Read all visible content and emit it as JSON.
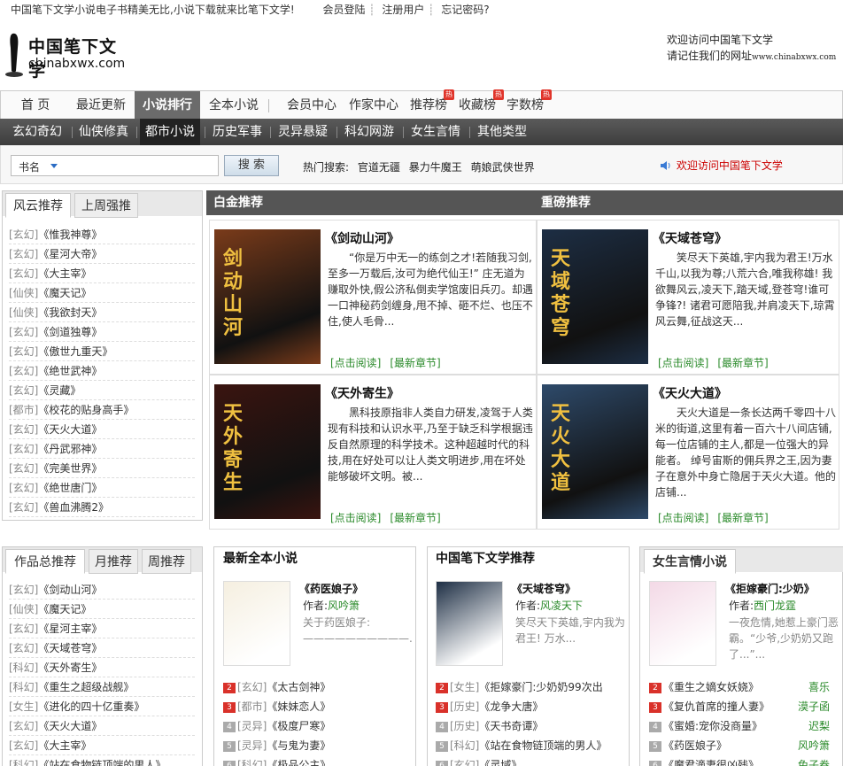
{
  "topbar": {
    "slogan": "中国笔下文学小说电子书精美无比,小说下载就来比笔下文学!",
    "login": "会员登陆",
    "register": "注册用户",
    "forgot": "忘记密码?"
  },
  "logo": {
    "cn": "中国笔下文学",
    "en": "chinabxwx.com"
  },
  "welcome": {
    "line1": "欢迎访问中国笔下文学",
    "line2": "请记住我们的网址",
    "url": "www.chinabxwx.com"
  },
  "nav": [
    "首 页",
    "最近更新",
    "小说排行",
    "全本小说",
    "会员中心",
    "作家中心",
    "推荐榜",
    "收藏榜",
    "字数榜"
  ],
  "hot_label": "热",
  "subnav": [
    "玄幻奇幻",
    "仙侠修真",
    "都市小说",
    "历史军事",
    "灵异悬疑",
    "科幻网游",
    "女生言情",
    "其他类型"
  ],
  "search": {
    "scope": "书名",
    "button": "搜 索",
    "hot_label": "热门搜索:",
    "hot": [
      "官道无疆",
      "暴力牛魔王",
      "萌娘武侠世界"
    ],
    "notice": "欢迎访问中国笔下文学"
  },
  "fengyun": {
    "tabs": [
      "风云推荐",
      "上周强推"
    ],
    "items": [
      [
        "[玄幻]",
        "《惟我神尊》"
      ],
      [
        "[玄幻]",
        "《星河大帝》"
      ],
      [
        "[玄幻]",
        "《大主宰》"
      ],
      [
        "[仙侠]",
        "《魔天记》"
      ],
      [
        "[仙侠]",
        "《我欲封天》"
      ],
      [
        "[玄幻]",
        "《剑道独尊》"
      ],
      [
        "[玄幻]",
        "《傲世九重天》"
      ],
      [
        "[玄幻]",
        "《绝世武神》"
      ],
      [
        "[玄幻]",
        "《灵藏》"
      ],
      [
        "[都市]",
        "《校花的贴身高手》"
      ],
      [
        "[玄幻]",
        "《天火大道》"
      ],
      [
        "[玄幻]",
        "《丹武邪神》"
      ],
      [
        "[玄幻]",
        "《完美世界》"
      ],
      [
        "[玄幻]",
        "《绝世唐门》"
      ],
      [
        "[玄幻]",
        "《兽血沸腾2》"
      ]
    ]
  },
  "baijin": {
    "title": "白金推荐"
  },
  "zhongbang": {
    "title": "重磅推荐"
  },
  "books": [
    {
      "title": "《剑动山河》",
      "desc": "“你是万中无一的练剑之才!若随我习剑,至多一万载后,汝可为绝代仙王!” 庄无道为赚取外快,假公济私倒卖学馆废旧兵刃。却遇一口神秘药剑缠身,甩不掉、砸不烂、也压不住,使人毛骨...",
      "read": "[点击阅读]",
      "latest": "[最新章节]",
      "cover_text": "剑动山河",
      "cover_color": "#7a3b1a"
    },
    {
      "title": "《天域苍穹》",
      "desc": "笑尽天下英雄,宇内我为君王!万水千山,以我为尊;八荒六合,唯我称雄! 我欲舞风云,凌天下,踏天域,登苍穹!谁可争锋?! 诸君可愿陪我,并肩凌天下,琼霄风云舞,征战这天...",
      "read": "[点击阅读]",
      "latest": "[最新章节]",
      "cover_text": "天域苍穹",
      "cover_color": "#1d2e44"
    },
    {
      "title": "《天外寄生》",
      "desc": "黑科技原指非人类自力研发,凌驾于人类现有科技和认识水平,乃至于缺乏科学根据违反自然原理的科学技术。这种超越时代的科技,用在好处可以让人类文明进步,用在坏处能够破坏文明。被...",
      "read": "[点击阅读]",
      "latest": "[最新章节]",
      "cover_text": "天外寄生",
      "cover_color": "#3a1410"
    },
    {
      "title": "《天火大道》",
      "desc": "天火大道是一条长达两千零四十八米的街道,这里有着一百六十八间店铺,每一位店铺的主人,都是一位强大的异能者。 绰号宙斯的佣兵界之王,因为妻子在意外中身亡隐居于天火大道。他的店铺...",
      "read": "[点击阅读]",
      "latest": "[最新章节]",
      "cover_text": "天火大道",
      "cover_color": "#2e4a6a"
    }
  ],
  "zongtui": {
    "tabs": [
      "作品总推荐",
      "月推荐",
      "周推荐"
    ],
    "items": [
      [
        "[玄幻]",
        "《剑动山河》"
      ],
      [
        "[仙侠]",
        "《魔天记》"
      ],
      [
        "[玄幻]",
        "《星河主宰》"
      ],
      [
        "[玄幻]",
        "《天域苍穹》"
      ],
      [
        "[科幻]",
        "《天外寄生》"
      ],
      [
        "[科幻]",
        "《重生之超级战舰》"
      ],
      [
        "[女生]",
        "《进化的四十亿重奏》"
      ],
      [
        "[玄幻]",
        "《天火大道》"
      ],
      [
        "[玄幻]",
        "《大主宰》"
      ],
      [
        "[科幻]",
        "《站在食物链顶端的男人》"
      ]
    ]
  },
  "quanben": {
    "title": "最新全本小说",
    "book": "《药医娘子》",
    "author_label": "作者:",
    "author": "风吟箫",
    "desc": "关于药医娘子: ——————————...",
    "items": [
      [
        "2",
        "[玄幻]",
        "《太古剑神》"
      ],
      [
        "3",
        "[都市]",
        "《妹妹恋人》"
      ],
      [
        "4",
        "[灵异]",
        "《极度尸寒》"
      ],
      [
        "5",
        "[灵异]",
        "《与鬼为妻》"
      ],
      [
        "6",
        "[科幻]",
        "《极品公主》"
      ]
    ]
  },
  "bxtuijian": {
    "title": "中国笔下文学推荐",
    "book": "《天域苍穹》",
    "author_label": "作者:",
    "author": "风凌天下",
    "desc": "笑尽天下英雄,宇内我为君王! 万水...",
    "items": [
      [
        "2",
        "[女生]",
        "《拒嫁豪门:少奶奶99次出"
      ],
      [
        "3",
        "[历史]",
        "《龙争大唐》"
      ],
      [
        "4",
        "[历史]",
        "《天书奇谭》"
      ],
      [
        "5",
        "[科幻]",
        "《站在食物链顶端的男人》"
      ],
      [
        "6",
        "[玄幻]",
        "《灵域》"
      ]
    ]
  },
  "nvsheng": {
    "title": "女生言情小说",
    "book": "《拒嫁豪门:少奶》",
    "author_label": "作者:",
    "author": "西门龙霆",
    "desc": "一夜危情,她惹上豪门恶霸。“少爷,少奶奶又跑了...”...",
    "items": [
      [
        "2",
        "《重生之嫡女妖娆》",
        "喜乐"
      ],
      [
        "3",
        "《复仇首席的撞人妻》",
        "漠子函"
      ],
      [
        "4",
        "《蜜婚:宠你没商量》",
        "迟梨"
      ],
      [
        "5",
        "《药医娘子》",
        "风吟箫"
      ],
      [
        "6",
        "《魔君滴妻很凶残》",
        "兔子券"
      ]
    ]
  }
}
